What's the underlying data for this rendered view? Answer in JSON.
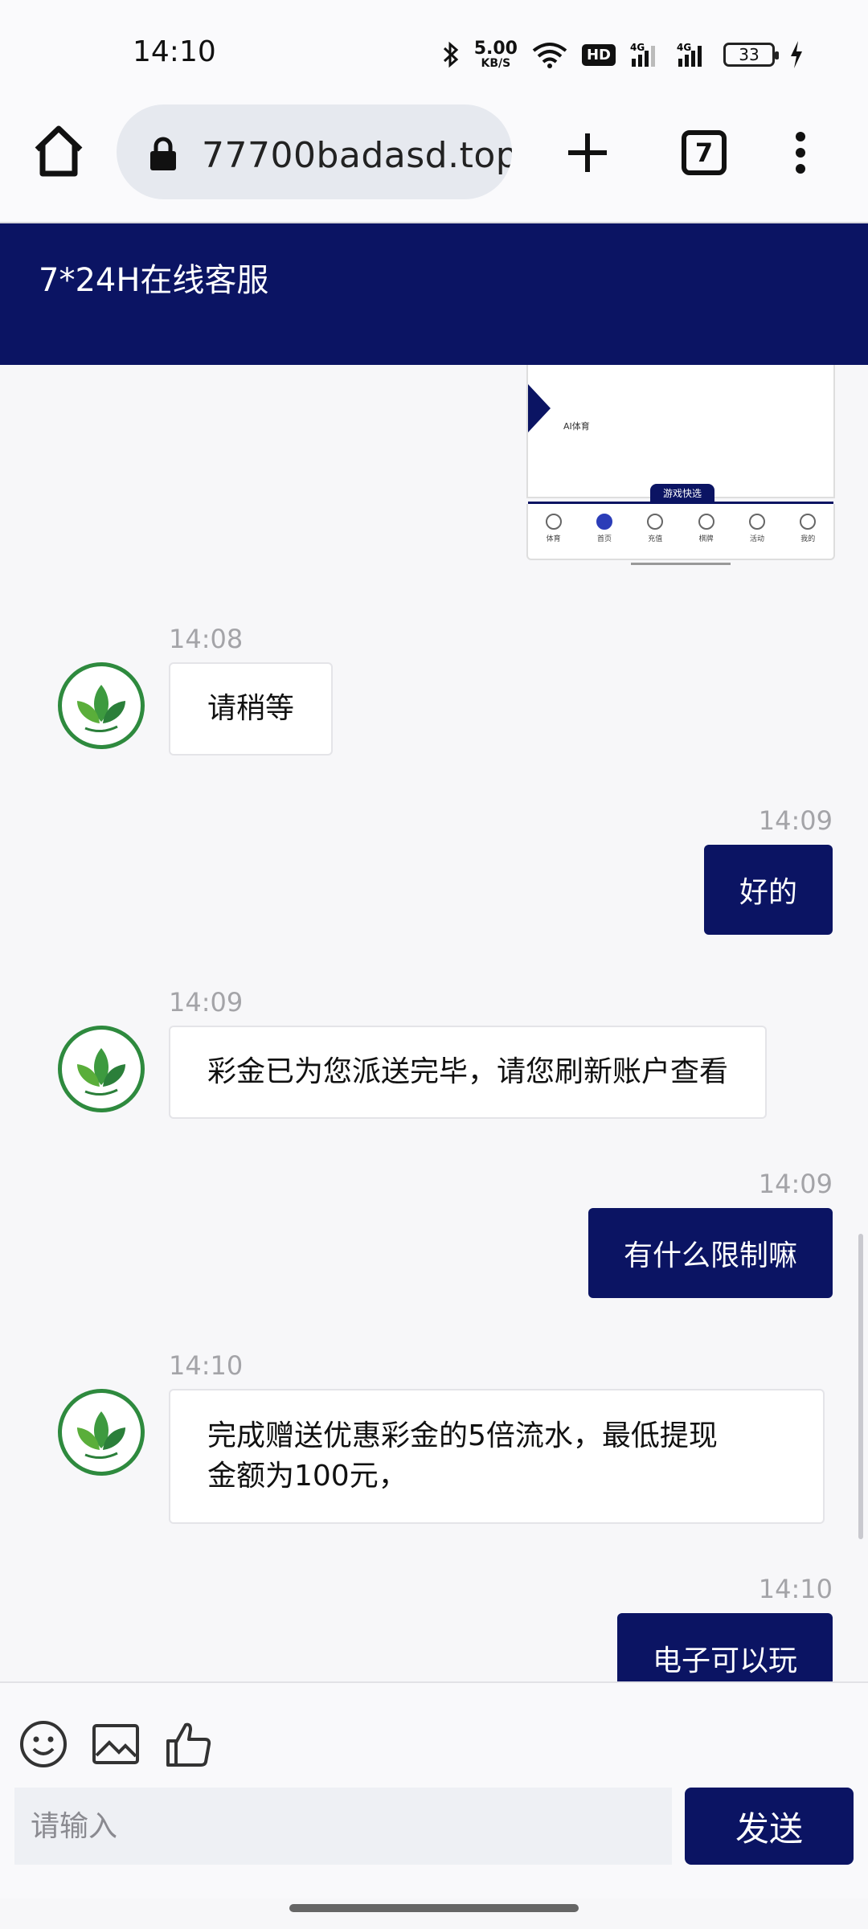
{
  "status_bar": {
    "time": "14:10",
    "speed_value": "5.00",
    "speed_unit": "KB/S",
    "hd_label": "HD",
    "network_1": "4G",
    "network_2": "4G",
    "battery_level": "33"
  },
  "browser": {
    "url": "77700badasd.top",
    "tab_count": "7"
  },
  "header": {
    "title": "7*24H在线客服"
  },
  "shared_image": {
    "label": "AI体育",
    "chip": "游戏快选",
    "nav": [
      "体育",
      "首页",
      "充值",
      "棋牌",
      "活动",
      "我的"
    ]
  },
  "messages": [
    {
      "side": "agent",
      "time": "14:08",
      "text": "请稍等"
    },
    {
      "side": "user",
      "time": "14:09",
      "text": "好的"
    },
    {
      "side": "agent",
      "time": "14:09",
      "text": "彩金已为您派送完毕，请您刷新账户查看"
    },
    {
      "side": "user",
      "time": "14:09",
      "text": "有什么限制嘛"
    },
    {
      "side": "agent",
      "time": "14:10",
      "text_line1": "完成赠送优惠彩金的5倍流水，最低提现",
      "text_line2": "金额为100元，"
    },
    {
      "side": "user",
      "time": "14:10",
      "text": "电子可以玩"
    }
  ],
  "input": {
    "placeholder": "请输入",
    "send_label": "发送"
  },
  "colors": {
    "brand": "#0b1463",
    "avatar_green": "#2e8a3e"
  }
}
